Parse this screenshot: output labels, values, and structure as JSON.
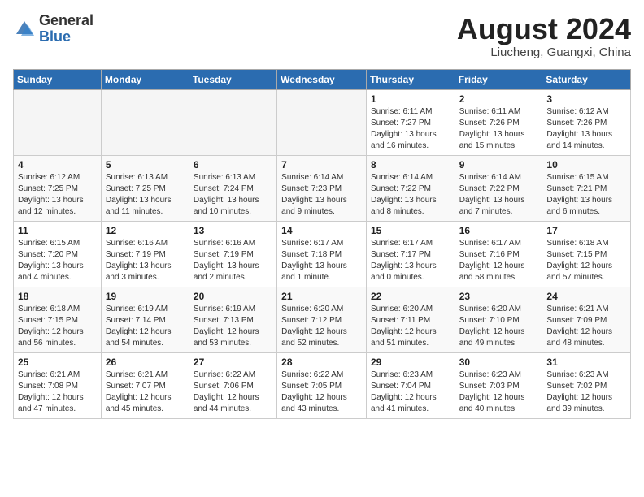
{
  "logo": {
    "general": "General",
    "blue": "Blue"
  },
  "header": {
    "month": "August 2024",
    "location": "Liucheng, Guangxi, China"
  },
  "weekdays": [
    "Sunday",
    "Monday",
    "Tuesday",
    "Wednesday",
    "Thursday",
    "Friday",
    "Saturday"
  ],
  "weeks": [
    [
      {
        "day": "",
        "detail": ""
      },
      {
        "day": "",
        "detail": ""
      },
      {
        "day": "",
        "detail": ""
      },
      {
        "day": "",
        "detail": ""
      },
      {
        "day": "1",
        "detail": "Sunrise: 6:11 AM\nSunset: 7:27 PM\nDaylight: 13 hours\nand 16 minutes."
      },
      {
        "day": "2",
        "detail": "Sunrise: 6:11 AM\nSunset: 7:26 PM\nDaylight: 13 hours\nand 15 minutes."
      },
      {
        "day": "3",
        "detail": "Sunrise: 6:12 AM\nSunset: 7:26 PM\nDaylight: 13 hours\nand 14 minutes."
      }
    ],
    [
      {
        "day": "4",
        "detail": "Sunrise: 6:12 AM\nSunset: 7:25 PM\nDaylight: 13 hours\nand 12 minutes."
      },
      {
        "day": "5",
        "detail": "Sunrise: 6:13 AM\nSunset: 7:25 PM\nDaylight: 13 hours\nand 11 minutes."
      },
      {
        "day": "6",
        "detail": "Sunrise: 6:13 AM\nSunset: 7:24 PM\nDaylight: 13 hours\nand 10 minutes."
      },
      {
        "day": "7",
        "detail": "Sunrise: 6:14 AM\nSunset: 7:23 PM\nDaylight: 13 hours\nand 9 minutes."
      },
      {
        "day": "8",
        "detail": "Sunrise: 6:14 AM\nSunset: 7:22 PM\nDaylight: 13 hours\nand 8 minutes."
      },
      {
        "day": "9",
        "detail": "Sunrise: 6:14 AM\nSunset: 7:22 PM\nDaylight: 13 hours\nand 7 minutes."
      },
      {
        "day": "10",
        "detail": "Sunrise: 6:15 AM\nSunset: 7:21 PM\nDaylight: 13 hours\nand 6 minutes."
      }
    ],
    [
      {
        "day": "11",
        "detail": "Sunrise: 6:15 AM\nSunset: 7:20 PM\nDaylight: 13 hours\nand 4 minutes."
      },
      {
        "day": "12",
        "detail": "Sunrise: 6:16 AM\nSunset: 7:19 PM\nDaylight: 13 hours\nand 3 minutes."
      },
      {
        "day": "13",
        "detail": "Sunrise: 6:16 AM\nSunset: 7:19 PM\nDaylight: 13 hours\nand 2 minutes."
      },
      {
        "day": "14",
        "detail": "Sunrise: 6:17 AM\nSunset: 7:18 PM\nDaylight: 13 hours\nand 1 minute."
      },
      {
        "day": "15",
        "detail": "Sunrise: 6:17 AM\nSunset: 7:17 PM\nDaylight: 13 hours\nand 0 minutes."
      },
      {
        "day": "16",
        "detail": "Sunrise: 6:17 AM\nSunset: 7:16 PM\nDaylight: 12 hours\nand 58 minutes."
      },
      {
        "day": "17",
        "detail": "Sunrise: 6:18 AM\nSunset: 7:15 PM\nDaylight: 12 hours\nand 57 minutes."
      }
    ],
    [
      {
        "day": "18",
        "detail": "Sunrise: 6:18 AM\nSunset: 7:15 PM\nDaylight: 12 hours\nand 56 minutes."
      },
      {
        "day": "19",
        "detail": "Sunrise: 6:19 AM\nSunset: 7:14 PM\nDaylight: 12 hours\nand 54 minutes."
      },
      {
        "day": "20",
        "detail": "Sunrise: 6:19 AM\nSunset: 7:13 PM\nDaylight: 12 hours\nand 53 minutes."
      },
      {
        "day": "21",
        "detail": "Sunrise: 6:20 AM\nSunset: 7:12 PM\nDaylight: 12 hours\nand 52 minutes."
      },
      {
        "day": "22",
        "detail": "Sunrise: 6:20 AM\nSunset: 7:11 PM\nDaylight: 12 hours\nand 51 minutes."
      },
      {
        "day": "23",
        "detail": "Sunrise: 6:20 AM\nSunset: 7:10 PM\nDaylight: 12 hours\nand 49 minutes."
      },
      {
        "day": "24",
        "detail": "Sunrise: 6:21 AM\nSunset: 7:09 PM\nDaylight: 12 hours\nand 48 minutes."
      }
    ],
    [
      {
        "day": "25",
        "detail": "Sunrise: 6:21 AM\nSunset: 7:08 PM\nDaylight: 12 hours\nand 47 minutes."
      },
      {
        "day": "26",
        "detail": "Sunrise: 6:21 AM\nSunset: 7:07 PM\nDaylight: 12 hours\nand 45 minutes."
      },
      {
        "day": "27",
        "detail": "Sunrise: 6:22 AM\nSunset: 7:06 PM\nDaylight: 12 hours\nand 44 minutes."
      },
      {
        "day": "28",
        "detail": "Sunrise: 6:22 AM\nSunset: 7:05 PM\nDaylight: 12 hours\nand 43 minutes."
      },
      {
        "day": "29",
        "detail": "Sunrise: 6:23 AM\nSunset: 7:04 PM\nDaylight: 12 hours\nand 41 minutes."
      },
      {
        "day": "30",
        "detail": "Sunrise: 6:23 AM\nSunset: 7:03 PM\nDaylight: 12 hours\nand 40 minutes."
      },
      {
        "day": "31",
        "detail": "Sunrise: 6:23 AM\nSunset: 7:02 PM\nDaylight: 12 hours\nand 39 minutes."
      }
    ]
  ]
}
